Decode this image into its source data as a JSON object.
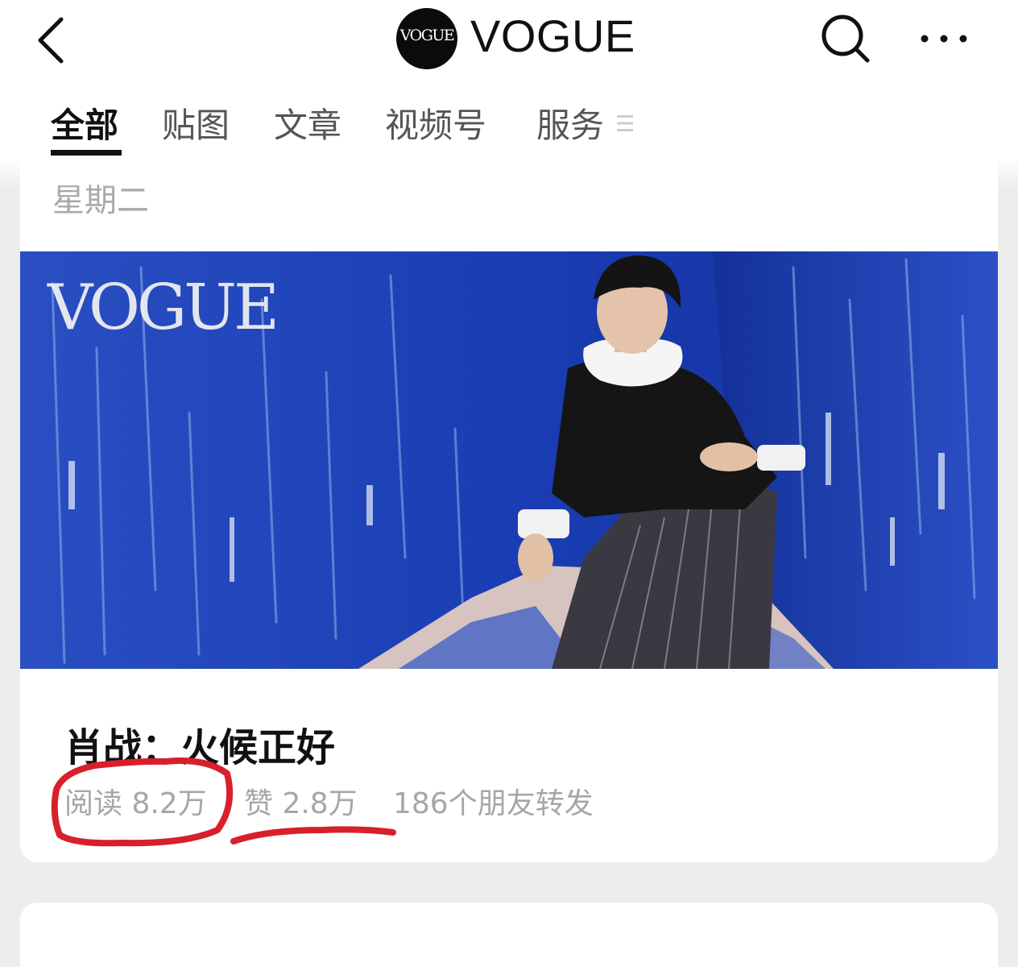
{
  "header": {
    "back_icon": "chevron-left-icon",
    "logo_text": "VOGUE",
    "account_name": "VOGUE",
    "search_icon": "search-icon",
    "more_icon": "more-dots-icon"
  },
  "tabs": [
    {
      "label": "全部",
      "active": true
    },
    {
      "label": "贴图",
      "active": false
    },
    {
      "label": "文章",
      "active": false
    },
    {
      "label": "视频号",
      "active": false
    },
    {
      "label": "服务",
      "active": false
    }
  ],
  "tab_more_icon": "menu-lines-icon",
  "article": {
    "date": "星期二",
    "cover_logo": "VOGUE",
    "title": "肖战：火候正好",
    "reads": "阅读 8.2万",
    "likes": "赞 2.8万",
    "shares": "186个朋友转发"
  },
  "colors": {
    "annotation_red": "#d8202a",
    "cover_blue": "#1b3eb5",
    "meta_gray": "#a6a6a6"
  }
}
